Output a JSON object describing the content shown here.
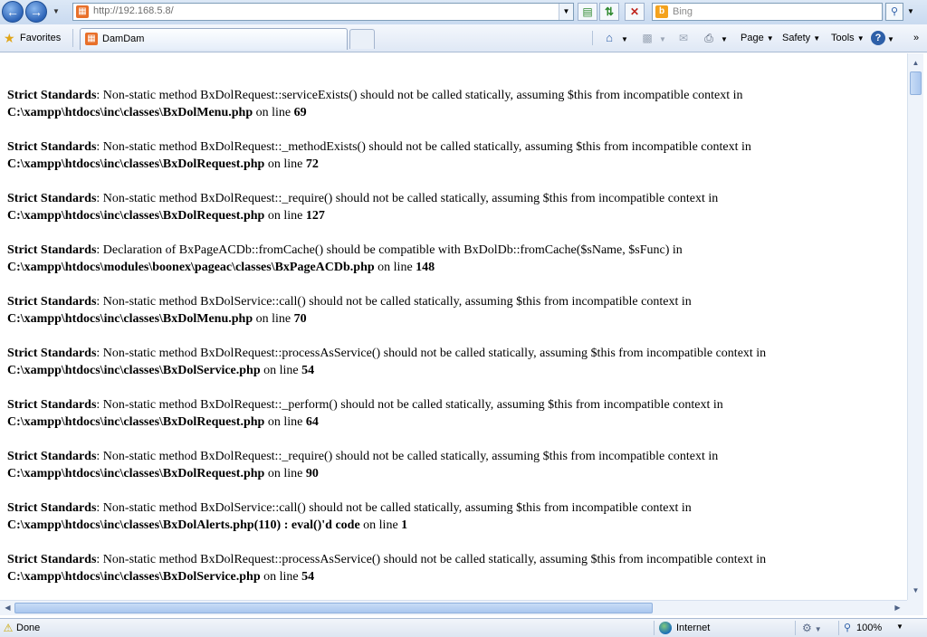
{
  "address_bar": {
    "url": "http://192.168.5.8/",
    "search_placeholder": "Bing"
  },
  "toolbar": {
    "favorites_label": "Favorites",
    "tab_title": "DamDam",
    "page_label": "Page",
    "safety_label": "Safety",
    "tools_label": "Tools"
  },
  "messages": [
    {
      "label": "Strict Standards",
      "text": ": Non-static method BxDolRequest::serviceExists() should not be called statically, assuming $this from incompatible context in",
      "file": "C:\\xampp\\htdocs\\inc\\classes\\BxDolMenu.php",
      "on_line": " on line ",
      "line": "69"
    },
    {
      "label": "Strict Standards",
      "text": ": Non-static method BxDolRequest::_methodExists() should not be called statically, assuming $this from incompatible context in",
      "file": "C:\\xampp\\htdocs\\inc\\classes\\BxDolRequest.php",
      "on_line": " on line ",
      "line": "72"
    },
    {
      "label": "Strict Standards",
      "text": ": Non-static method BxDolRequest::_require() should not be called statically, assuming $this from incompatible context in",
      "file": "C:\\xampp\\htdocs\\inc\\classes\\BxDolRequest.php",
      "on_line": " on line ",
      "line": "127"
    },
    {
      "label": "Strict Standards",
      "text": ": Declaration of BxPageACDb::fromCache() should be compatible with BxDolDb::fromCache($sName, $sFunc) in",
      "file": "C:\\xampp\\htdocs\\modules\\boonex\\pageac\\classes\\BxPageACDb.php",
      "on_line": " on line ",
      "line": "148"
    },
    {
      "label": "Strict Standards",
      "text": ": Non-static method BxDolService::call() should not be called statically, assuming $this from incompatible context in",
      "file": "C:\\xampp\\htdocs\\inc\\classes\\BxDolMenu.php",
      "on_line": " on line ",
      "line": "70"
    },
    {
      "label": "Strict Standards",
      "text": ": Non-static method BxDolRequest::processAsService() should not be called statically, assuming $this from incompatible context in",
      "file": "C:\\xampp\\htdocs\\inc\\classes\\BxDolService.php",
      "on_line": " on line ",
      "line": "54"
    },
    {
      "label": "Strict Standards",
      "text": ": Non-static method BxDolRequest::_perform() should not be called statically, assuming $this from incompatible context in",
      "file": "C:\\xampp\\htdocs\\inc\\classes\\BxDolRequest.php",
      "on_line": " on line ",
      "line": "64"
    },
    {
      "label": "Strict Standards",
      "text": ": Non-static method BxDolRequest::_require() should not be called statically, assuming $this from incompatible context in",
      "file": "C:\\xampp\\htdocs\\inc\\classes\\BxDolRequest.php",
      "on_line": " on line ",
      "line": "90"
    },
    {
      "label": "Strict Standards",
      "text": ": Non-static method BxDolService::call() should not be called statically, assuming $this from incompatible context in",
      "file": "C:\\xampp\\htdocs\\inc\\classes\\BxDolAlerts.php(110) : eval()'d code",
      "on_line": " on line ",
      "line": "1"
    },
    {
      "label": "Strict Standards",
      "text": ": Non-static method BxDolRequest::processAsService() should not be called statically, assuming $this from incompatible context in",
      "file": "C:\\xampp\\htdocs\\inc\\classes\\BxDolService.php",
      "on_line": " on line ",
      "line": "54"
    }
  ],
  "status_bar": {
    "status_text": "Done",
    "zone_label": "Internet",
    "zoom_level": "100%"
  }
}
